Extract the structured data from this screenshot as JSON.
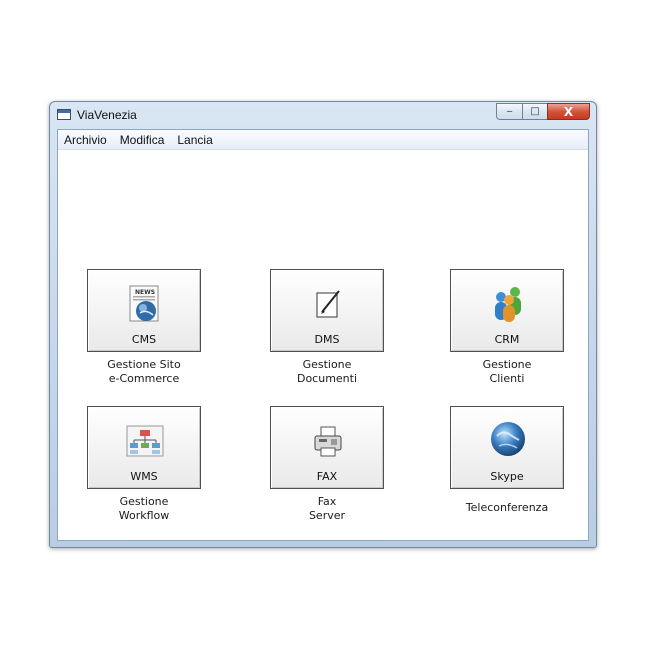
{
  "window": {
    "title": "ViaVenezia"
  },
  "caption_buttons": {
    "minimize": "‒",
    "maximize": "□",
    "close": "X"
  },
  "menu": [
    {
      "label": "Archivio"
    },
    {
      "label": "Modifica"
    },
    {
      "label": "Lancia"
    }
  ],
  "tiles": [
    {
      "label": "CMS",
      "caption": [
        "Gestione Sito",
        "e-Commerce"
      ],
      "icon": "news-globe-icon"
    },
    {
      "label": "DMS",
      "caption": [
        "Gestione",
        "Documenti"
      ],
      "icon": "document-pen-icon"
    },
    {
      "label": "CRM",
      "caption": [
        "Gestione",
        "Clienti"
      ],
      "icon": "people-group-icon"
    },
    {
      "label": "WMS",
      "caption": [
        "Gestione",
        "Workflow"
      ],
      "icon": "workflow-chart-icon"
    },
    {
      "label": "FAX",
      "caption": [
        "Fax",
        "Server"
      ],
      "icon": "fax-machine-icon"
    },
    {
      "label": "Skype",
      "caption": [
        "Teleconferenza"
      ],
      "icon": "globe-icon"
    }
  ],
  "colors": {
    "window_frame": "#c4d6ea",
    "close_button": "#c43a1f",
    "tile_border": "#505050"
  }
}
